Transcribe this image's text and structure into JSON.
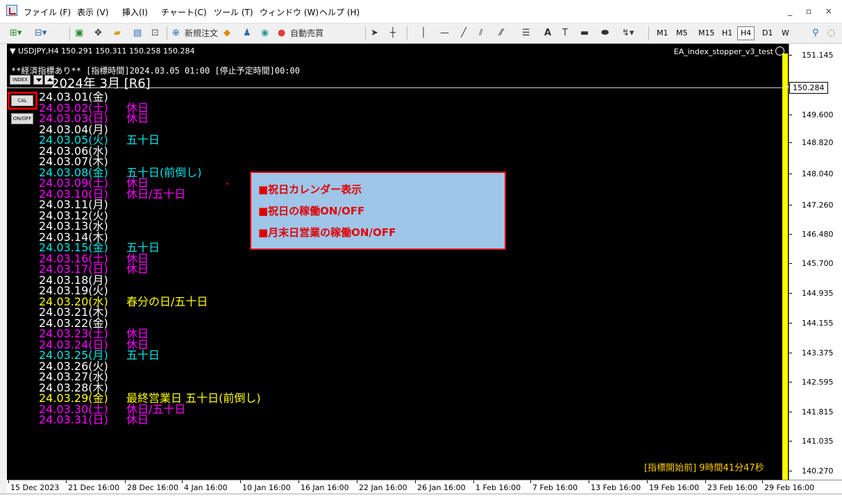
{
  "menu": {
    "items": [
      "ファイル (F)",
      "表示 (V)",
      "挿入(I)",
      "チャート(C)",
      "ツール (T)",
      "ウィンドウ (W)",
      "ヘルプ (H)"
    ],
    "window_controls": "_ ▫ ×"
  },
  "toolbar": {
    "new_order": "新規注文",
    "auto_trade": "自動売買",
    "timeframes": [
      "M1",
      "M5",
      "M15",
      "H1",
      "H4",
      "D1",
      "W"
    ],
    "active_timeframe": "H4"
  },
  "chart": {
    "symbol_line": "▼ USDJPY,H4  150.291 150.311 150.258 150.284",
    "ea_name": "EA_index_stopper_v3_test",
    "info_line": "**経済指標あり** [指標時間]2024.03.05 01:00 [停止予定時間]00:00",
    "index_button": "INDEX",
    "cal_button": "CAL",
    "onoff_button": "ON/OFF",
    "month_title": "2024年 3月 [R6]",
    "countdown": "[指標開始前] 9時間41分47秒",
    "current_price": "150.284",
    "price_ticks": [
      "151.145",
      "149.600",
      "148.820",
      "148.040",
      "147.260",
      "146.480",
      "145.700",
      "144.935",
      "144.155",
      "143.375",
      "142.595",
      "141.815",
      "141.035",
      "140.270"
    ],
    "time_ticks": [
      "15 Dec 2023",
      "21 Dec 16:00",
      "28 Dec 16:00",
      "4 Jan 16:00",
      "10 Jan 16:00",
      "16 Jan 16:00",
      "22 Jan 16:00",
      "26 Jan 16:00",
      "1 Feb 16:00",
      "7 Feb 16:00",
      "13 Feb 16:00",
      "19 Feb 16:00",
      "23 Feb 16:00",
      "29 Feb 16:00"
    ]
  },
  "colors": {
    "weekday": "#ffffff",
    "holiday": "#ff00ff",
    "gotobi": "#00e5e5",
    "special": "#ffff00"
  },
  "calendar": [
    {
      "date": "24.03.01(金)",
      "note": "",
      "type": "weekday"
    },
    {
      "date": "24.03.02(土)",
      "note": "休日",
      "type": "holiday"
    },
    {
      "date": "24.03.03(日)",
      "note": "休日",
      "type": "holiday"
    },
    {
      "date": "24.03.04(月)",
      "note": "",
      "type": "weekday"
    },
    {
      "date": "24.03.05(火)",
      "note": "五十日",
      "type": "gotobi"
    },
    {
      "date": "24.03.06(水)",
      "note": "",
      "type": "weekday"
    },
    {
      "date": "24.03.07(木)",
      "note": "",
      "type": "weekday"
    },
    {
      "date": "24.03.08(金)",
      "note": "五十日(前倒し)",
      "type": "gotobi"
    },
    {
      "date": "24.03.09(土)",
      "note": "休日",
      "type": "holiday"
    },
    {
      "date": "24.03.10(日)",
      "note": "休日/五十日",
      "type": "holiday"
    },
    {
      "date": "24.03.11(月)",
      "note": "",
      "type": "weekday"
    },
    {
      "date": "24.03.12(火)",
      "note": "",
      "type": "weekday"
    },
    {
      "date": "24.03.13(水)",
      "note": "",
      "type": "weekday"
    },
    {
      "date": "24.03.14(木)",
      "note": "",
      "type": "weekday"
    },
    {
      "date": "24.03.15(金)",
      "note": "五十日",
      "type": "gotobi"
    },
    {
      "date": "24.03.16(土)",
      "note": "休日",
      "type": "holiday"
    },
    {
      "date": "24.03.17(日)",
      "note": "休日",
      "type": "holiday"
    },
    {
      "date": "24.03.18(月)",
      "note": "",
      "type": "weekday"
    },
    {
      "date": "24.03.19(火)",
      "note": "",
      "type": "weekday"
    },
    {
      "date": "24.03.20(水)",
      "note": "春分の日/五十日",
      "type": "special"
    },
    {
      "date": "24.03.21(木)",
      "note": "",
      "type": "weekday"
    },
    {
      "date": "24.03.22(金)",
      "note": "",
      "type": "weekday"
    },
    {
      "date": "24.03.23(土)",
      "note": "休日",
      "type": "holiday"
    },
    {
      "date": "24.03.24(日)",
      "note": "休日",
      "type": "holiday"
    },
    {
      "date": "24.03.25(月)",
      "note": "五十日",
      "type": "gotobi"
    },
    {
      "date": "24.03.26(火)",
      "note": "",
      "type": "weekday"
    },
    {
      "date": "24.03.27(水)",
      "note": "",
      "type": "weekday"
    },
    {
      "date": "24.03.28(木)",
      "note": "",
      "type": "weekday"
    },
    {
      "date": "24.03.29(金)",
      "note": "最終営業日 五十日(前倒し)",
      "type": "special"
    },
    {
      "date": "24.03.30(土)",
      "note": "休日/五十日",
      "type": "holiday"
    },
    {
      "date": "24.03.31(日)",
      "note": "休日",
      "type": "holiday"
    }
  ],
  "annotation": {
    "lines": [
      "■祝日カレンダー表示",
      "■祝日の稼働ON/OFF",
      "■月末日営業の稼働ON/OFF"
    ]
  }
}
